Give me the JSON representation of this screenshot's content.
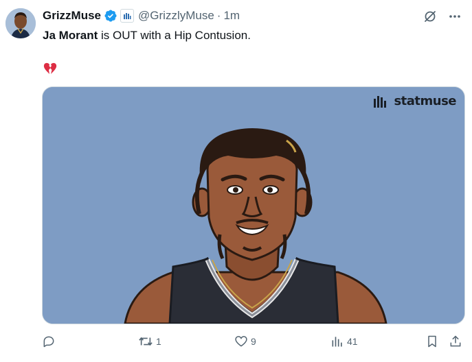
{
  "author": {
    "display_name": "GrizzMuse",
    "handle": "@GrizzlyMuse",
    "separator": "·",
    "time": "1m",
    "avatar_icon": "grizzlies-player-avatar",
    "verified_icon": "verified-badge-icon",
    "affiliation_icon": "statmuse-affiliate-icon"
  },
  "tweet": {
    "text_bold": "Ja Morant",
    "text_rest": " is OUT with a Hip Contusion.",
    "emoji": "broken-heart"
  },
  "media": {
    "watermark_text": "statmuse",
    "background_color": "#7e9cc4"
  },
  "actions": {
    "reply_count": "",
    "retweet_count": "1",
    "like_count": "9",
    "views_count": "41"
  },
  "colors": {
    "text_primary": "#0f1419",
    "text_secondary": "#536471",
    "verified_blue": "#1d9bf0",
    "border": "#cfd9de"
  }
}
